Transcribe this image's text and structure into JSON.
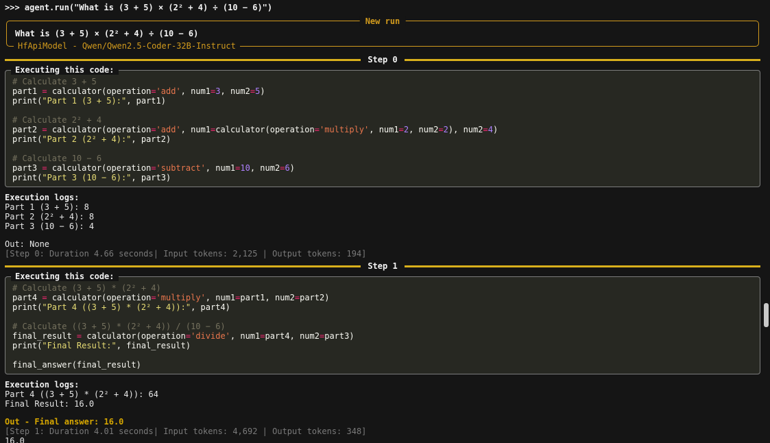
{
  "colors": {
    "background": "#151515",
    "code_background": "#272822",
    "panel_accent": "#d19a1d",
    "rule_accent": "#d9b01c",
    "final_answer_accent": "#d7a700"
  },
  "terminal": {
    "repl_line": ">>> agent.run(\"What is (3 + 5) × (2² + 4) ÷ (10 − 6)\")",
    "return_value": "16.0"
  },
  "new_run": {
    "title": "New run",
    "task": "What is (3 + 5) × (2² + 4) ÷ (10 − 6)",
    "model": "HfApiModel - Qwen/Qwen2.5-Coder-32B-Instruct"
  },
  "steps": [
    {
      "label": "Step 0",
      "code_title": "Executing this code:",
      "code": [
        [
          [
            "c",
            "# Calculate 3 + 5"
          ]
        ],
        [
          [
            "p",
            "part1 "
          ],
          [
            "o",
            "="
          ],
          [
            "p",
            " calculator(operation"
          ],
          [
            "o",
            "="
          ],
          [
            "s",
            "'add'"
          ],
          [
            "p",
            ", num1"
          ],
          [
            "o",
            "="
          ],
          [
            "n",
            "3"
          ],
          [
            "p",
            ", num2"
          ],
          [
            "o",
            "="
          ],
          [
            "n",
            "5"
          ],
          [
            "p",
            ")"
          ]
        ],
        [
          [
            "p",
            "print("
          ],
          [
            "y",
            "\"Part 1 (3 + 5):\""
          ],
          [
            "p",
            ", part1)"
          ]
        ],
        [],
        [
          [
            "c",
            "# Calculate 2² + 4"
          ]
        ],
        [
          [
            "p",
            "part2 "
          ],
          [
            "o",
            "="
          ],
          [
            "p",
            " calculator(operation"
          ],
          [
            "o",
            "="
          ],
          [
            "s",
            "'add'"
          ],
          [
            "p",
            ", num1"
          ],
          [
            "o",
            "="
          ],
          [
            "p",
            "calculator(operation"
          ],
          [
            "o",
            "="
          ],
          [
            "s",
            "'multiply'"
          ],
          [
            "p",
            ", num1"
          ],
          [
            "o",
            "="
          ],
          [
            "n",
            "2"
          ],
          [
            "p",
            ", num2"
          ],
          [
            "o",
            "="
          ],
          [
            "n",
            "2"
          ],
          [
            "p",
            "), num2"
          ],
          [
            "o",
            "="
          ],
          [
            "n",
            "4"
          ],
          [
            "p",
            ")"
          ]
        ],
        [
          [
            "p",
            "print("
          ],
          [
            "y",
            "\"Part 2 (2² + 4):\""
          ],
          [
            "p",
            ", part2)"
          ]
        ],
        [],
        [
          [
            "c",
            "# Calculate 10 − 6"
          ]
        ],
        [
          [
            "p",
            "part3 "
          ],
          [
            "o",
            "="
          ],
          [
            "p",
            " calculator(operation"
          ],
          [
            "o",
            "="
          ],
          [
            "s",
            "'subtract'"
          ],
          [
            "p",
            ", num1"
          ],
          [
            "o",
            "="
          ],
          [
            "n",
            "10"
          ],
          [
            "p",
            ", num2"
          ],
          [
            "o",
            "="
          ],
          [
            "n",
            "6"
          ],
          [
            "p",
            ")"
          ]
        ],
        [
          [
            "p",
            "print("
          ],
          [
            "y",
            "\"Part 3 (10 − 6):\""
          ],
          [
            "p",
            ", part3)"
          ]
        ]
      ],
      "logs_title": "Execution logs:",
      "logs": [
        "Part 1 (3 + 5): 8",
        "Part 2 (2² + 4): 8",
        "Part 3 (10 − 6): 4"
      ],
      "out": "Out: None",
      "out_final": false,
      "footer": "[Step 0: Duration 4.66 seconds| Input tokens: 2,125 | Output tokens: 194]"
    },
    {
      "label": "Step 1",
      "code_title": "Executing this code:",
      "code": [
        [
          [
            "c",
            "# Calculate (3 + 5) * (2² + 4)"
          ]
        ],
        [
          [
            "p",
            "part4 "
          ],
          [
            "o",
            "="
          ],
          [
            "p",
            " calculator(operation"
          ],
          [
            "o",
            "="
          ],
          [
            "s",
            "'multiply'"
          ],
          [
            "p",
            ", num1"
          ],
          [
            "o",
            "="
          ],
          [
            "p",
            "part1, num2"
          ],
          [
            "o",
            "="
          ],
          [
            "p",
            "part2)"
          ]
        ],
        [
          [
            "p",
            "print("
          ],
          [
            "y",
            "\"Part 4 ((3 + 5) * (2² + 4)):\""
          ],
          [
            "p",
            ", part4)"
          ]
        ],
        [],
        [
          [
            "c",
            "# Calculate ((3 + 5) * (2² + 4)) / (10 − 6)"
          ]
        ],
        [
          [
            "p",
            "final_result "
          ],
          [
            "o",
            "="
          ],
          [
            "p",
            " calculator(operation"
          ],
          [
            "o",
            "="
          ],
          [
            "s",
            "'divide'"
          ],
          [
            "p",
            ", num1"
          ],
          [
            "o",
            "="
          ],
          [
            "p",
            "part4, num2"
          ],
          [
            "o",
            "="
          ],
          [
            "p",
            "part3)"
          ]
        ],
        [
          [
            "p",
            "print("
          ],
          [
            "y",
            "\"Final Result:\""
          ],
          [
            "p",
            ", final_result)"
          ]
        ],
        [],
        [
          [
            "p",
            "final_answer(final_result)"
          ]
        ]
      ],
      "logs_title": "Execution logs:",
      "logs": [
        "Part 4 ((3 + 5) * (2² + 4)): 64",
        "Final Result: 16.0"
      ],
      "out": "Out - Final answer: 16.0",
      "out_final": true,
      "footer": "[Step 1: Duration 4.01 seconds| Input tokens: 4,692 | Output tokens: 348]"
    }
  ]
}
